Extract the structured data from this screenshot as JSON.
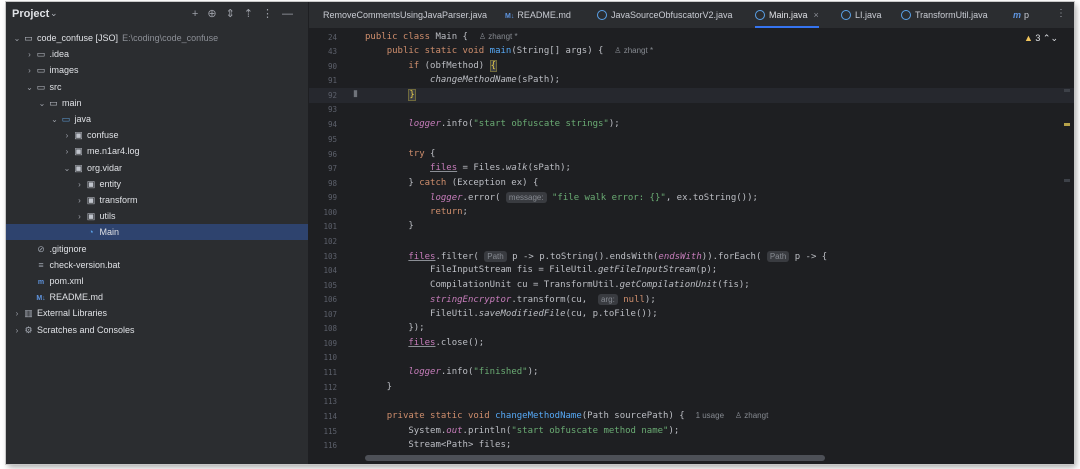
{
  "project": {
    "title": "Project",
    "tree": [
      {
        "indent": 0,
        "arrow": "⌄",
        "icon": "folder-icon",
        "label": "code_confuse [JSO]",
        "suffix": "E:\\coding\\code_confuse"
      },
      {
        "indent": 1,
        "arrow": "›",
        "icon": "folder-icon",
        "label": ".idea"
      },
      {
        "indent": 1,
        "arrow": "›",
        "icon": "folder-icon",
        "label": "images"
      },
      {
        "indent": 1,
        "arrow": "⌄",
        "icon": "folder-icon",
        "label": "src"
      },
      {
        "indent": 2,
        "arrow": "⌄",
        "icon": "folder-icon",
        "label": "main"
      },
      {
        "indent": 3,
        "arrow": "⌄",
        "icon": "source-folder-icon",
        "label": "java"
      },
      {
        "indent": 4,
        "arrow": "›",
        "icon": "package-icon",
        "label": "confuse"
      },
      {
        "indent": 4,
        "arrow": "›",
        "icon": "package-icon",
        "label": "me.n1ar4.log"
      },
      {
        "indent": 4,
        "arrow": "⌄",
        "icon": "package-icon",
        "label": "org.vidar"
      },
      {
        "indent": 5,
        "arrow": "›",
        "icon": "package-icon",
        "label": "entity"
      },
      {
        "indent": 5,
        "arrow": "›",
        "icon": "package-icon",
        "label": "transform"
      },
      {
        "indent": 5,
        "arrow": "›",
        "icon": "package-icon",
        "label": "utils"
      },
      {
        "indent": 5,
        "arrow": "",
        "icon": "java-class-icon",
        "label": "Main",
        "selected": true
      },
      {
        "indent": 1,
        "arrow": "",
        "icon": "gitignore-icon",
        "label": ".gitignore"
      },
      {
        "indent": 1,
        "arrow": "",
        "icon": "batch-file-icon",
        "label": "check-version.bat"
      },
      {
        "indent": 1,
        "arrow": "",
        "icon": "maven-icon",
        "label": "pom.xml"
      },
      {
        "indent": 1,
        "arrow": "",
        "icon": "markdown-icon",
        "label": "README.md"
      },
      {
        "indent": 0,
        "arrow": "›",
        "icon": "library-icon",
        "label": "External Libraries"
      },
      {
        "indent": 0,
        "arrow": "›",
        "icon": "scratches-icon",
        "label": "Scratches and Consoles"
      }
    ]
  },
  "tabs": [
    {
      "label": "RemoveCommentsUsingJavaParser.java",
      "icon": "none",
      "close": ""
    },
    {
      "label": "README.md",
      "icon": "markdown",
      "close": ""
    },
    {
      "label": "JavaSourceObfuscatorV2.java",
      "icon": "java",
      "close": ""
    },
    {
      "label": "Main.java",
      "icon": "java",
      "close": "×",
      "active": true
    },
    {
      "label": "LI.java",
      "icon": "java",
      "close": ""
    },
    {
      "label": "TransformUtil.java",
      "icon": "java",
      "close": ""
    },
    {
      "label": "p",
      "icon": "maven",
      "close": ""
    }
  ],
  "editor": {
    "warnings": "3",
    "line_numbers": [
      "24",
      "43",
      "90",
      "91",
      "92",
      "93",
      "94",
      "95",
      "96",
      "97",
      "98",
      "99",
      "100",
      "101",
      "102",
      "103",
      "104",
      "105",
      "106",
      "107",
      "108",
      "109",
      "110",
      "111",
      "112",
      "113",
      "114",
      "115",
      "116"
    ],
    "hints": {
      "author_main": "zhangt *",
      "author_method": "zhangt *",
      "param_message": "message:",
      "param_path1": "Path",
      "param_path2": "Path",
      "param_arg": "arg:",
      "usage": "1 usage",
      "author_change": "zhangt"
    },
    "strings": {
      "start_strings": "\"start obfuscate strings\"",
      "walk_error": "\"file walk error: {}\"",
      "finished": "\"finished\"",
      "start_method": "\"start obfuscate method name\""
    }
  }
}
